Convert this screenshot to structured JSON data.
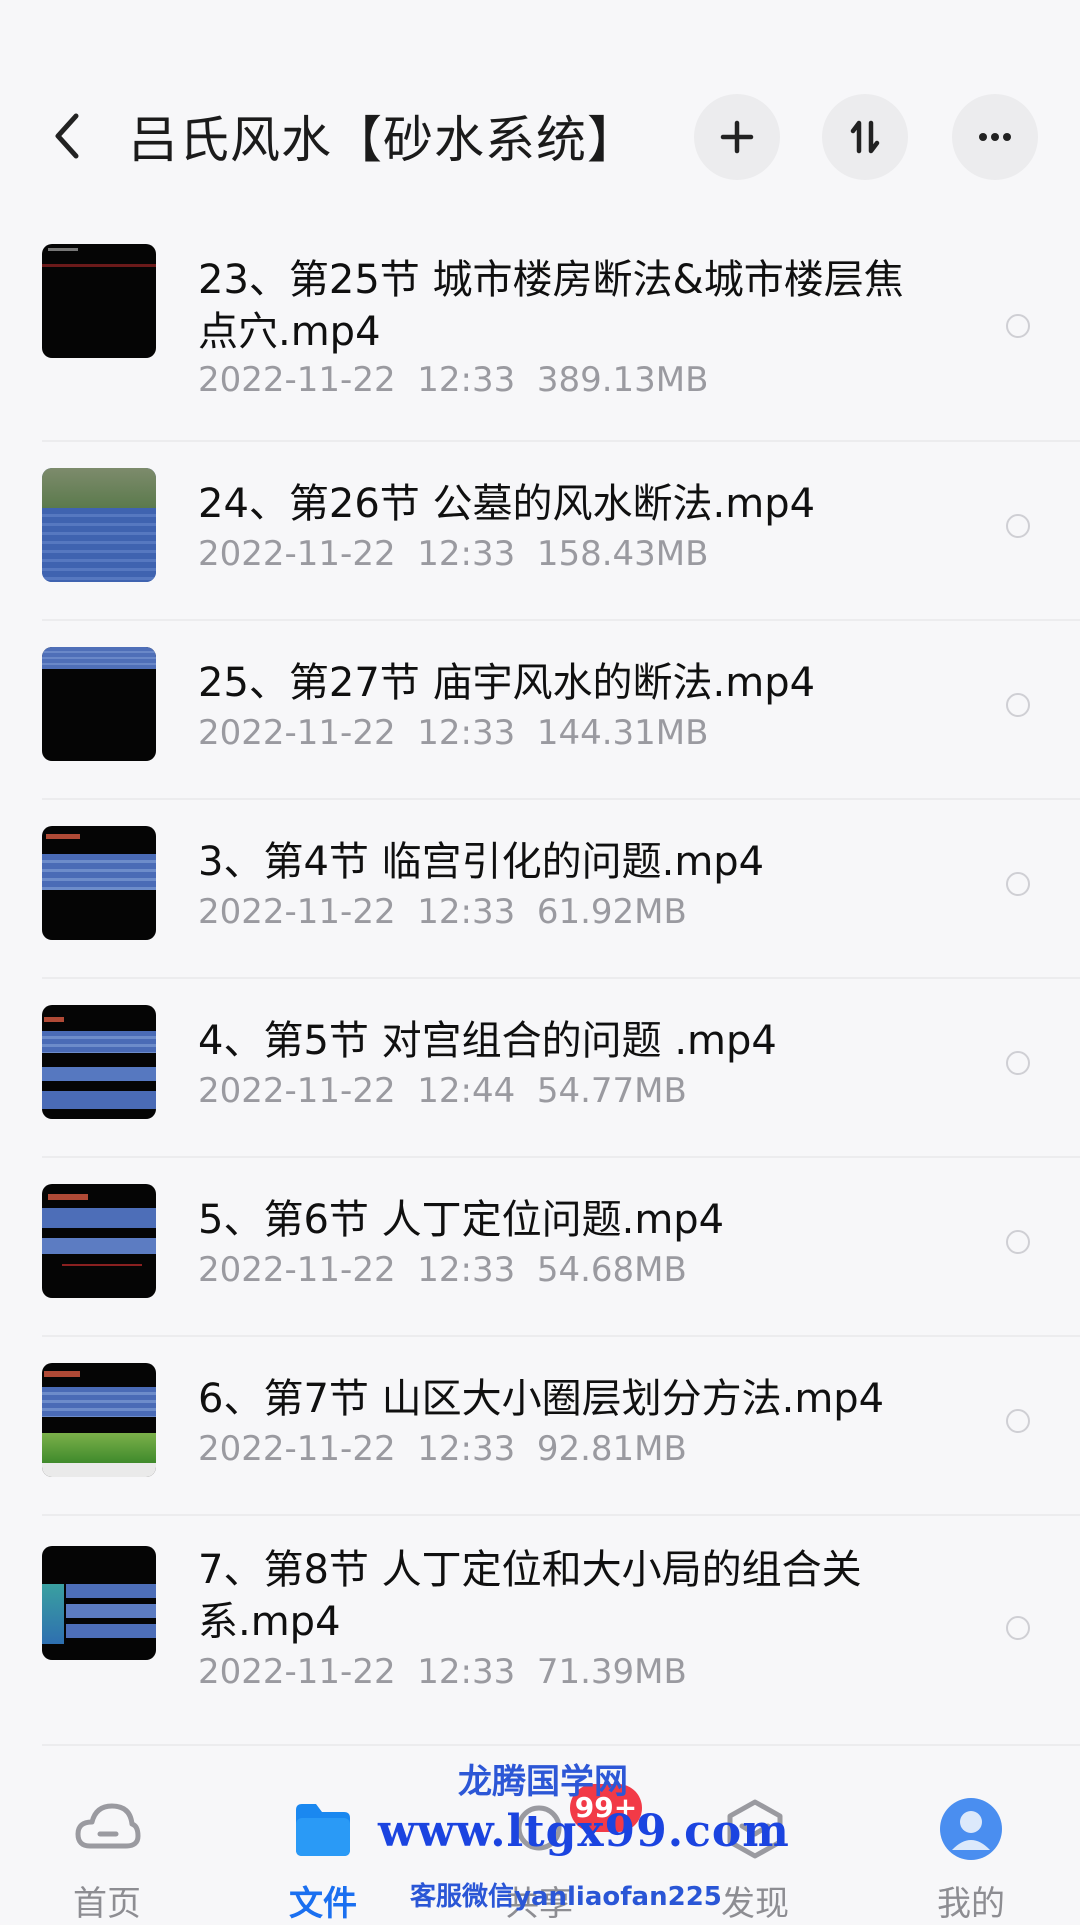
{
  "header": {
    "title": "吕氏风水【砂水系统】",
    "icons": {
      "back": "chevron-left-icon",
      "add": "plus-icon",
      "sort": "sort-icon",
      "more": "more-icon"
    }
  },
  "files": [
    {
      "name": "23、第25节 城市楼房断法&城市楼层焦点穴.mp4",
      "date": "2022-11-22",
      "time": "12:33",
      "size": "389.13MB",
      "thumb": "dark-red-line"
    },
    {
      "name": "24、第26节 公墓的风水断法.mp4",
      "date": "2022-11-22",
      "time": "12:33",
      "size": "158.43MB",
      "thumb": "landscape-blue"
    },
    {
      "name": "25、第27节 庙宇风水的断法.mp4",
      "date": "2022-11-22",
      "time": "12:33",
      "size": "144.31MB",
      "thumb": "blue-top-dark"
    },
    {
      "name": "3、第4节 临宫引化的问题.mp4",
      "date": "2022-11-22",
      "time": "12:33",
      "size": "61.92MB",
      "thumb": "blue-band"
    },
    {
      "name": "4、第5节 对宫组合的问题 .mp4",
      "date": "2022-11-22",
      "time": "12:44",
      "size": "54.77MB",
      "thumb": "blue-slides"
    },
    {
      "name": "5、第6节 人丁定位问题.mp4",
      "date": "2022-11-22",
      "time": "12:33",
      "size": "54.68MB",
      "thumb": "blue-slides-red"
    },
    {
      "name": "6、第7节 山区大小圈层划分方法.mp4",
      "date": "2022-11-22",
      "time": "12:33",
      "size": "92.81MB",
      "thumb": "green-hills"
    },
    {
      "name": "7、第8节 人丁定位和大小局的组合关系.mp4",
      "date": "2022-11-22",
      "time": "12:33",
      "size": "71.39MB",
      "thumb": "blue-teal"
    }
  ],
  "nav": {
    "items": [
      {
        "label": "首页",
        "icon": "cloud-icon"
      },
      {
        "label": "文件",
        "icon": "folder-icon"
      },
      {
        "label": "共享",
        "icon": "share-icon"
      },
      {
        "label": "发现",
        "icon": "discover-icon"
      },
      {
        "label": "我的",
        "icon": "avatar-icon"
      }
    ],
    "badge": "99+"
  },
  "watermark": {
    "line1": "龙腾国学网",
    "line2": "www.ltgx99.com",
    "line3": "客服微信yanliaofan225"
  },
  "colors": {
    "accent": "#1a6ff0",
    "badge": "#f23a47",
    "background": "#f7f7f9"
  }
}
